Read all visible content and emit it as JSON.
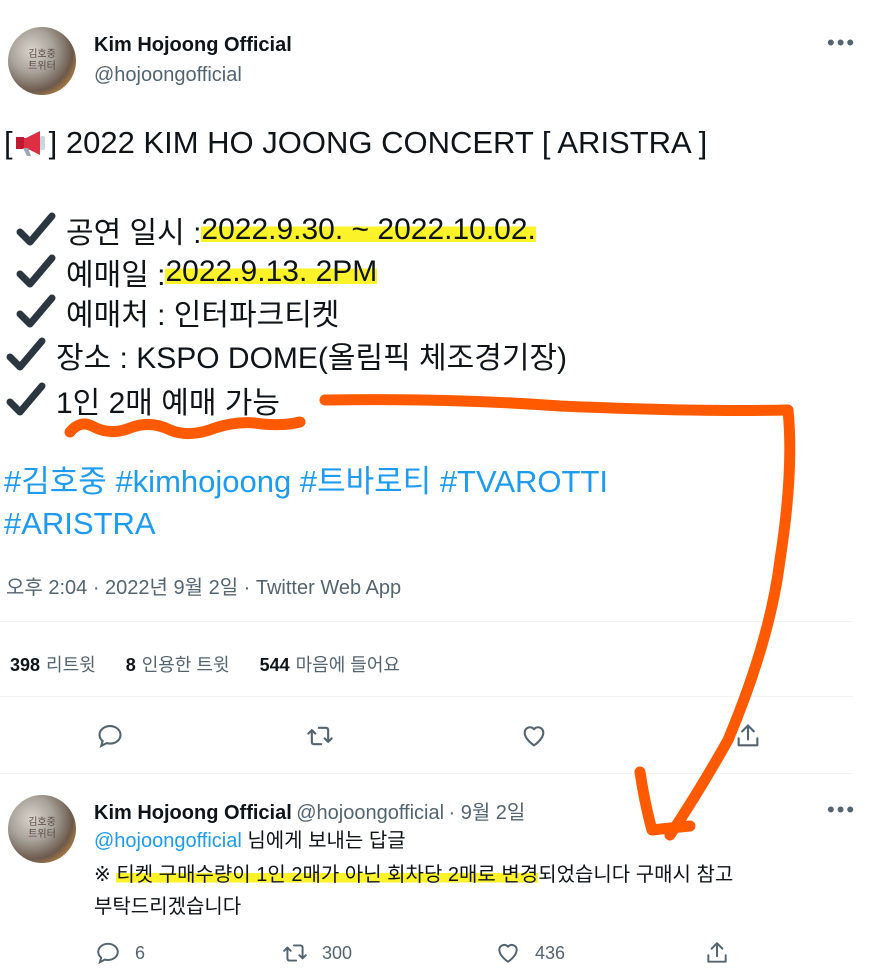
{
  "tweet": {
    "author_name": "Kim Hojoong Official",
    "author_handle": "@hojoongofficial",
    "avatar_text": "김호중\n트위터",
    "title_prefix": "[",
    "title_suffix": "] 2022 KIM HO JOONG CONCERT [ ARISTRA ]",
    "items": [
      {
        "label": "공연 일시 : ",
        "value": "2022.9.30. ~ 2022.10.02."
      },
      {
        "label": "예매일 : ",
        "value": "2022.9.13. 2PM"
      },
      {
        "label": "예매처 : 인터파크티켓",
        "value": ""
      },
      {
        "label": "장소 : KSPO DOME(올림픽 체조경기장)",
        "value": ""
      },
      {
        "label": "1인 2매 예매 가능",
        "value": ""
      }
    ],
    "hashtags_line1": [
      "#김호중",
      "#kimhojoong",
      "#트바로티",
      "#TVAROTTI"
    ],
    "hashtags_line2": [
      "#ARISTRA"
    ],
    "timestamp": "오후 2:04 · 2022년 9월 2일 · Twitter Web App",
    "stats": {
      "retweets_count": "398",
      "retweets_label": "리트윗",
      "quotes_count": "8",
      "quotes_label": "인용한 트윗",
      "likes_count": "544",
      "likes_label": "마음에 들어요"
    }
  },
  "reply": {
    "author_name": "Kim Hojoong Official",
    "author_handle": "@hojoongofficial",
    "date": "· 9월 2일",
    "replying_to_handle": "@hojoongofficial",
    "replying_to_suffix": "님에게 보내는 답글",
    "body_prefix": "※ ",
    "body_highlight": "티켓 구매수량이 1인 2매가 아닌 회차당 2매로 변경",
    "body_rest": "되었습니다 구매시 참고",
    "body_line2": "부탁드리겠습니다",
    "reply_count": "6",
    "retweet_count": "300",
    "like_count": "436"
  },
  "icons": {
    "more": "more-icon",
    "reply": "reply-icon",
    "retweet": "retweet-icon",
    "like": "heart-icon",
    "share": "share-icon",
    "megaphone": "megaphone-icon",
    "check": "check-icon"
  },
  "colors": {
    "link": "#1d9bf0",
    "muted": "#536471",
    "highlight": "#fcf22a",
    "annotation": "#ff5a00"
  }
}
